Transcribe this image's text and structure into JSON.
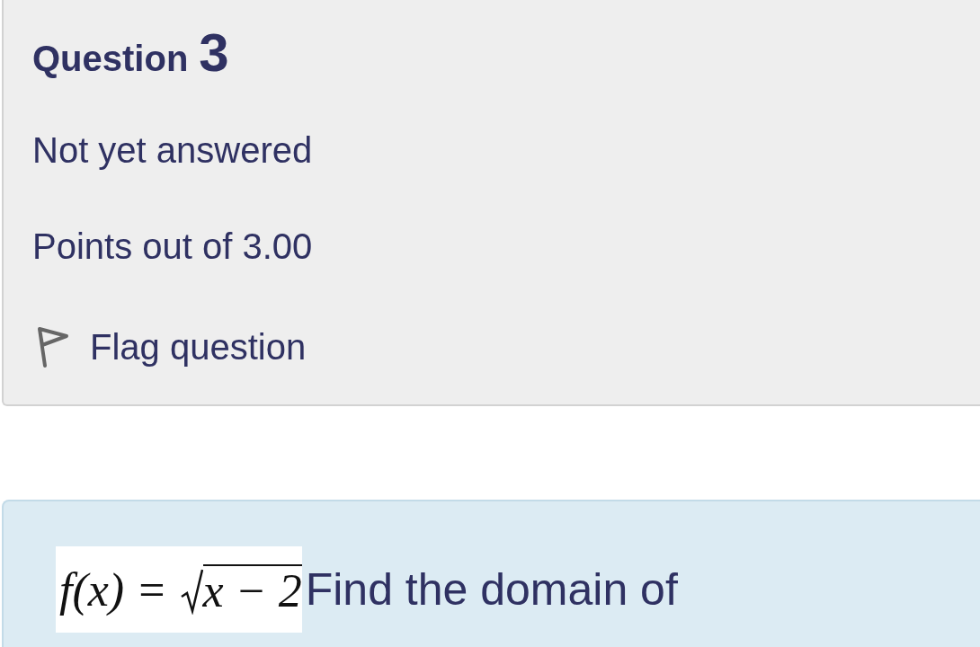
{
  "info": {
    "heading": "Question",
    "number": "3",
    "state": "Not yet answered",
    "points": "Points out of 3.00",
    "flag": {
      "label": "Flag question",
      "flagged": false
    }
  },
  "question": {
    "formula": {
      "left": "f(x)",
      "equals": "=",
      "radicand": "x − 2"
    },
    "text": "Find the domain of"
  }
}
